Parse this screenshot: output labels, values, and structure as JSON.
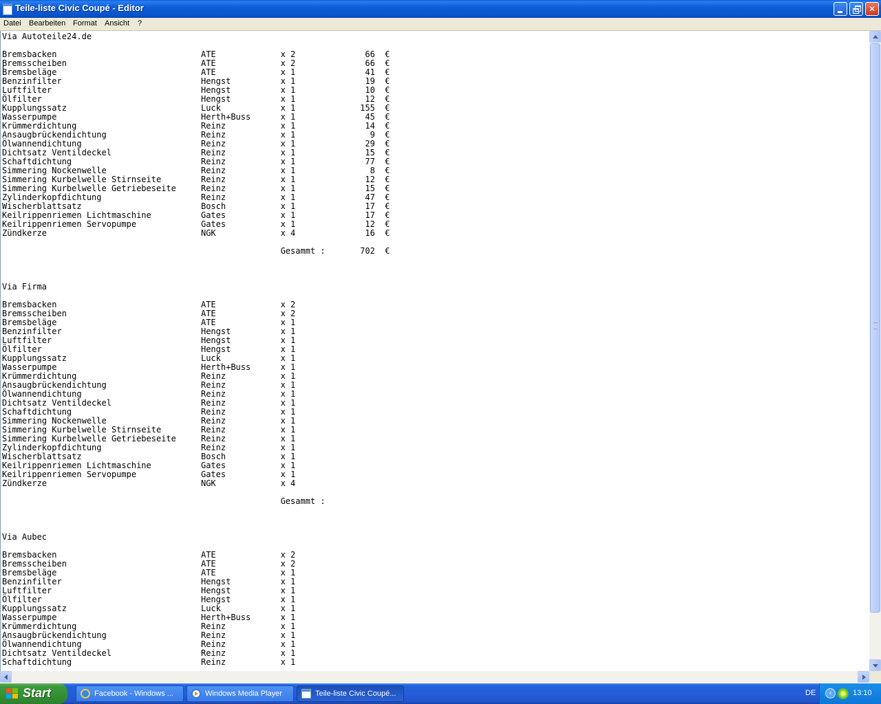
{
  "window": {
    "title": "Teile-liste Civic Coupé - Editor"
  },
  "menu": [
    "Datei",
    "Bearbeiten",
    "Format",
    "Ansicht",
    "?"
  ],
  "document": {
    "sections": [
      {
        "heading": "Via Autoteile24.de",
        "rows": [
          {
            "part": "Bremsbacken",
            "brand": "ATE",
            "qty": "x 2",
            "price": "66",
            "currency": "€"
          },
          {
            "part": "Bremsscheiben",
            "brand": "ATE",
            "qty": "x 2",
            "price": "66",
            "currency": "€"
          },
          {
            "part": "Bremsbeläge",
            "brand": "ATE",
            "qty": "x 1",
            "price": "41",
            "currency": "€"
          },
          {
            "part": "Benzinfilter",
            "brand": "Hengst",
            "qty": "x 1",
            "price": "19",
            "currency": "€"
          },
          {
            "part": "Luftfilter",
            "brand": "Hengst",
            "qty": "x 1",
            "price": "10",
            "currency": "€"
          },
          {
            "part": "Ölfilter",
            "brand": "Hengst",
            "qty": "x 1",
            "price": "12",
            "currency": "€"
          },
          {
            "part": "Kupplungssatz",
            "brand": "Luck",
            "qty": "x 1",
            "price": "155",
            "currency": "€"
          },
          {
            "part": "Wasserpumpe",
            "brand": "Herth+Buss",
            "qty": "x 1",
            "price": "45",
            "currency": "€"
          },
          {
            "part": "Krümmerdichtung",
            "brand": "Reinz",
            "qty": "x 1",
            "price": "14",
            "currency": "€"
          },
          {
            "part": "Ansaugbrückendichtung",
            "brand": "Reinz",
            "qty": "x 1",
            "price": "9",
            "currency": "€"
          },
          {
            "part": "Ölwannendichtung",
            "brand": "Reinz",
            "qty": "x 1",
            "price": "29",
            "currency": "€"
          },
          {
            "part": "Dichtsatz Ventildeckel",
            "brand": "Reinz",
            "qty": "x 1",
            "price": "15",
            "currency": "€"
          },
          {
            "part": "Schaftdichtung",
            "brand": "Reinz",
            "qty": "x 1",
            "price": "77",
            "currency": "€"
          },
          {
            "part": "Simmering Nockenwelle",
            "brand": "Reinz",
            "qty": "x 1",
            "price": "8",
            "currency": "€"
          },
          {
            "part": "Simmering Kurbelwelle Stirnseite",
            "brand": "Reinz",
            "qty": "x 1",
            "price": "12",
            "currency": "€"
          },
          {
            "part": "Simmering Kurbelwelle Getriebeseite",
            "brand": "Reinz",
            "qty": "x 1",
            "price": "15",
            "currency": "€"
          },
          {
            "part": "Zylinderkopfdichtung",
            "brand": "Reinz",
            "qty": "x 1",
            "price": "47",
            "currency": "€"
          },
          {
            "part": "Wischerblattsatz",
            "brand": "Bosch",
            "qty": "x 1",
            "price": "17",
            "currency": "€"
          },
          {
            "part": "Keilrippenriemen Lichtmaschine",
            "brand": "Gates",
            "qty": "x 1",
            "price": "17",
            "currency": "€"
          },
          {
            "part": "Keilrippenriemen Servopumpe",
            "brand": "Gates",
            "qty": "x 1",
            "price": "12",
            "currency": "€"
          },
          {
            "part": "Zündkerze",
            "brand": "NGK",
            "qty": "x 4",
            "price": "16",
            "currency": "€"
          }
        ],
        "total": {
          "label": "Gesammt :",
          "value": "702",
          "currency": "€"
        }
      },
      {
        "heading": "Via Firma",
        "rows": [
          {
            "part": "Bremsbacken",
            "brand": "ATE",
            "qty": "x 2"
          },
          {
            "part": "Bremsscheiben",
            "brand": "ATE",
            "qty": "x 2"
          },
          {
            "part": "Bremsbeläge",
            "brand": "ATE",
            "qty": "x 1"
          },
          {
            "part": "Benzinfilter",
            "brand": "Hengst",
            "qty": "x 1"
          },
          {
            "part": "Luftfilter",
            "brand": "Hengst",
            "qty": "x 1"
          },
          {
            "part": "Ölfilter",
            "brand": "Hengst",
            "qty": "x 1"
          },
          {
            "part": "Kupplungssatz",
            "brand": "Luck",
            "qty": "x 1"
          },
          {
            "part": "Wasserpumpe",
            "brand": "Herth+Buss",
            "qty": "x 1"
          },
          {
            "part": "Krümmerdichtung",
            "brand": "Reinz",
            "qty": "x 1"
          },
          {
            "part": "Ansaugbrückendichtung",
            "brand": "Reinz",
            "qty": "x 1"
          },
          {
            "part": "Ölwannendichtung",
            "brand": "Reinz",
            "qty": "x 1"
          },
          {
            "part": "Dichtsatz Ventildeckel",
            "brand": "Reinz",
            "qty": "x 1"
          },
          {
            "part": "Schaftdichtung",
            "brand": "Reinz",
            "qty": "x 1"
          },
          {
            "part": "Simmering Nockenwelle",
            "brand": "Reinz",
            "qty": "x 1"
          },
          {
            "part": "Simmering Kurbelwelle Stirnseite",
            "brand": "Reinz",
            "qty": "x 1"
          },
          {
            "part": "Simmering Kurbelwelle Getriebeseite",
            "brand": "Reinz",
            "qty": "x 1"
          },
          {
            "part": "Zylinderkopfdichtung",
            "brand": "Reinz",
            "qty": "x 1"
          },
          {
            "part": "Wischerblattsatz",
            "brand": "Bosch",
            "qty": "x 1"
          },
          {
            "part": "Keilrippenriemen Lichtmaschine",
            "brand": "Gates",
            "qty": "x 1"
          },
          {
            "part": "Keilrippenriemen Servopumpe",
            "brand": "Gates",
            "qty": "x 1"
          },
          {
            "part": "Zündkerze",
            "brand": "NGK",
            "qty": "x 4"
          }
        ],
        "total": {
          "label": "Gesammt :"
        }
      },
      {
        "heading": "Via Aubec",
        "rows": [
          {
            "part": "Bremsbacken",
            "brand": "ATE",
            "qty": "x 2"
          },
          {
            "part": "Bremsscheiben",
            "brand": "ATE",
            "qty": "x 2"
          },
          {
            "part": "Bremsbeläge",
            "brand": "ATE",
            "qty": "x 1"
          },
          {
            "part": "Benzinfilter",
            "brand": "Hengst",
            "qty": "x 1"
          },
          {
            "part": "Luftfilter",
            "brand": "Hengst",
            "qty": "x 1"
          },
          {
            "part": "Ölfilter",
            "brand": "Hengst",
            "qty": "x 1"
          },
          {
            "part": "Kupplungssatz",
            "brand": "Luck",
            "qty": "x 1"
          },
          {
            "part": "Wasserpumpe",
            "brand": "Herth+Buss",
            "qty": "x 1"
          },
          {
            "part": "Krümmerdichtung",
            "brand": "Reinz",
            "qty": "x 1"
          },
          {
            "part": "Ansaugbrückendichtung",
            "brand": "Reinz",
            "qty": "x 1"
          },
          {
            "part": "Ölwannendichtung",
            "brand": "Reinz",
            "qty": "x 1"
          },
          {
            "part": "Dichtsatz Ventildeckel",
            "brand": "Reinz",
            "qty": "x 1"
          },
          {
            "part": "Schaftdichtung",
            "brand": "Reinz",
            "qty": "x 1"
          }
        ]
      }
    ]
  },
  "taskbar": {
    "start_label": "Start",
    "tasks": [
      {
        "label": "Facebook - Windows ...",
        "icon": "internet-explorer-icon"
      },
      {
        "label": "Windows Media Player",
        "icon": "media-player-icon"
      },
      {
        "label": "Teile-liste Civic Coupé...",
        "icon": "notepad-icon",
        "active": true
      }
    ],
    "language": "DE",
    "clock": "13:10"
  }
}
